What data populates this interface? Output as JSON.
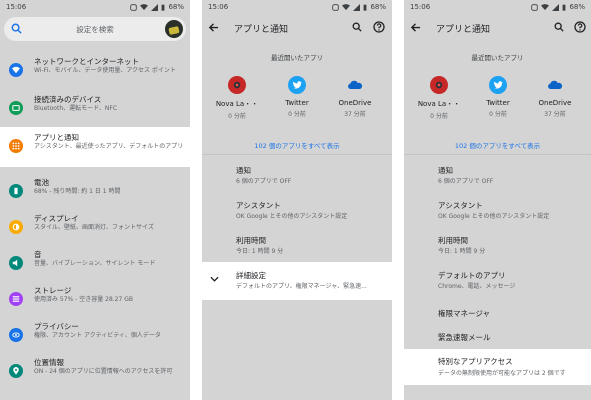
{
  "status": {
    "time": "15:06",
    "battery": "68%"
  },
  "panel1": {
    "search_placeholder": "設定を検索",
    "items": [
      {
        "title": "ネットワークとインターネット",
        "sub": "Wi-Fi、モバイル、データ使用量、アクセス ポイント",
        "icon": "wifi-icon",
        "color": "#1a73e8"
      },
      {
        "title": "接続済みのデバイス",
        "sub": "Bluetooth、運転モード、NFC",
        "icon": "devices-icon",
        "color": "#0f9d58"
      },
      {
        "title": "アプリと通知",
        "sub": "アシスタント、最近使ったアプリ、デフォルトのアプリ",
        "icon": "apps-icon",
        "color": "#f57c00"
      },
      {
        "title": "電池",
        "sub": "68% - 残り時間: 約 1 日 1 時間",
        "icon": "battery-icon",
        "color": "#00897b"
      },
      {
        "title": "ディスプレイ",
        "sub": "スタイル、壁紙、画面消灯、フォントサイズ",
        "icon": "display-icon",
        "color": "#f9ab00"
      },
      {
        "title": "音",
        "sub": "音量、バイブレーション、サイレント モード",
        "icon": "sound-icon",
        "color": "#00897b"
      },
      {
        "title": "ストレージ",
        "sub": "使用済み 57% - 空き容量 28.27 GB",
        "icon": "storage-icon",
        "color": "#a142f4"
      },
      {
        "title": "プライバシー",
        "sub": "権限、アカウント アクティビティ、個人データ",
        "icon": "privacy-icon",
        "color": "#1a73e8"
      },
      {
        "title": "位置情報",
        "sub": "ON - 24 個のアプリに位置情報へのアクセスを許可",
        "icon": "location-icon",
        "color": "#00897b"
      }
    ]
  },
  "appbar": {
    "title": "アプリと通知"
  },
  "recent": {
    "title": "最近開いたアプリ",
    "apps": [
      {
        "name": "Nova La・・",
        "time": "0 分前",
        "icon": "nova-launcher-icon",
        "color": "#c62828"
      },
      {
        "name": "Twitter",
        "time": "0 分前",
        "icon": "twitter-icon",
        "color": "#1da1f2"
      },
      {
        "name": "OneDrive",
        "time": "37 分前",
        "icon": "onedrive-icon",
        "color": "#0a64c8"
      }
    ],
    "see_all": "102 個のアプリをすべて表示"
  },
  "panel2": {
    "rows": [
      {
        "title": "通知",
        "sub": "6 個のアプリで OFF"
      },
      {
        "title": "アシスタント",
        "sub": "OK Google とその他のアシスタント設定"
      },
      {
        "title": "利用時間",
        "sub": "今日: 1 時間 9 分"
      },
      {
        "title": "詳細設定",
        "sub": "デフォルトのアプリ、権限マネージャ、緊急速..."
      }
    ]
  },
  "panel3": {
    "rows": [
      {
        "title": "通知",
        "sub": "6 個のアプリで OFF"
      },
      {
        "title": "アシスタント",
        "sub": "OK Google とその他のアシスタント設定"
      },
      {
        "title": "利用時間",
        "sub": "今日: 1 時間 9 分"
      },
      {
        "title": "デフォルトのアプリ",
        "sub": "Chrome、電話、メッセージ"
      },
      {
        "title": "権限マネージャ",
        "sub": ""
      },
      {
        "title": "緊急速報メール",
        "sub": ""
      },
      {
        "title": "特別なアプリアクセス",
        "sub": "データの無制限使用が可能なアプリは 2 個です"
      }
    ]
  }
}
